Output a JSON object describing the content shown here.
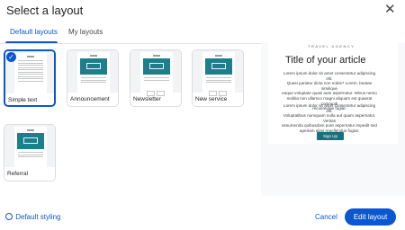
{
  "dialog": {
    "title": "Select a layout",
    "close_icon": "close-icon"
  },
  "tabs": [
    {
      "label": "Default layouts",
      "active": true
    },
    {
      "label": "My layouts",
      "active": false
    }
  ],
  "layouts": [
    {
      "label": "Simple text",
      "selected": true
    },
    {
      "label": "Announcement",
      "selected": false
    },
    {
      "label": "Newsletter",
      "selected": false
    },
    {
      "label": "New service",
      "selected": false
    },
    {
      "label": "Referral",
      "selected": false
    }
  ],
  "preview": {
    "brand": "TRAVEL AGENCY",
    "title": "Title of your article",
    "body1": "Lorem ipsum dolor sit amet consectetur adipiscing elit.\nQuasi pariatur dicta non nobis? Lorem, beatae similique\neaque voluptate quasi aute aspernatur. Minus nemo\nmolitia non ullamco magni aliquam est quaerat commodi\nrecusandae fugiat.",
    "body2": "Lorem ipsum dolor sit amet consectetur adipiscing elit.\nVoluptatibus numquam nulla aut quam aspernatur. Veritas\nassumenda quibusdam pure aspernatur impedit sed\naperiam alias repellendus fugiat.",
    "button": "Sign Up"
  },
  "footer": {
    "default_styling": "Default styling",
    "cancel": "Cancel",
    "edit_layout": "Edit layout"
  },
  "colors": {
    "accent": "#0b57d0",
    "teal": "#1d7f8c"
  }
}
